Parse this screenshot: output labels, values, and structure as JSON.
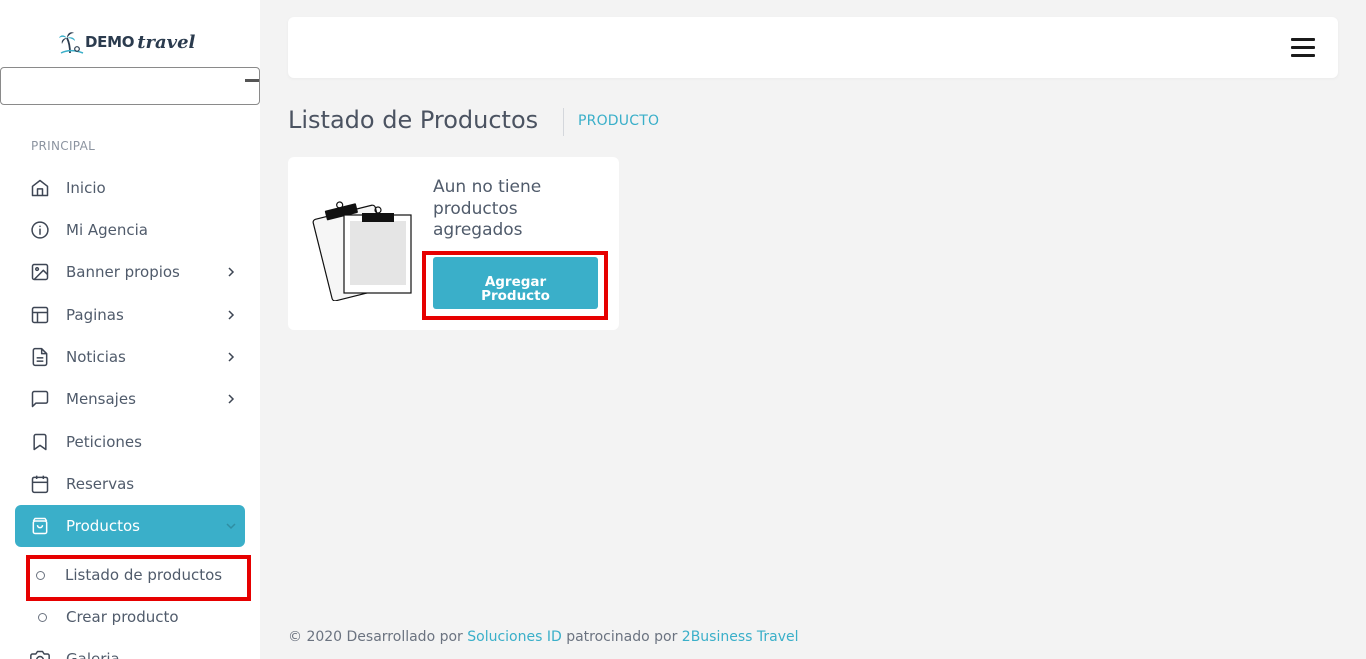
{
  "brand": {
    "logo_text": "DEMO",
    "logo_script": "travel"
  },
  "sidebar": {
    "section_label": "PRINCIPAL",
    "items": [
      {
        "label": "Inicio",
        "icon": "home-icon"
      },
      {
        "label": "Mi Agencia",
        "icon": "info-icon"
      },
      {
        "label": "Banner propios",
        "icon": "image-icon",
        "has_children": true
      },
      {
        "label": "Paginas",
        "icon": "layout-icon",
        "has_children": true
      },
      {
        "label": "Noticias",
        "icon": "file-text-icon",
        "has_children": true
      },
      {
        "label": "Mensajes",
        "icon": "message-icon",
        "has_children": true
      },
      {
        "label": "Peticiones",
        "icon": "bookmark-icon"
      },
      {
        "label": "Reservas",
        "icon": "calendar-icon"
      },
      {
        "label": "Productos",
        "icon": "shopping-bag-icon",
        "has_children": true,
        "active": true
      },
      {
        "label": "Galeria",
        "icon": "camera-icon"
      }
    ],
    "sub_items": [
      {
        "label": "Listado de productos",
        "highlighted": true
      },
      {
        "label": "Crear producto"
      }
    ]
  },
  "header": {
    "menu_icon": "hamburger-icon"
  },
  "page": {
    "title": "Listado de Productos",
    "breadcrumb": "PRODUCTO"
  },
  "empty_card": {
    "message_lines": [
      "Aun no tiene",
      "productos",
      "agregados"
    ],
    "button_lines": [
      "Agregar",
      "Producto"
    ]
  },
  "footer": {
    "prefix": "© 2020 Desarrollado por ",
    "link1": "Soluciones ID",
    "middle": " patrocinado por ",
    "link2": "2Business Travel"
  },
  "colors": {
    "accent": "#3aafc9",
    "highlight": "#e60000",
    "background": "#f3f3f3"
  }
}
